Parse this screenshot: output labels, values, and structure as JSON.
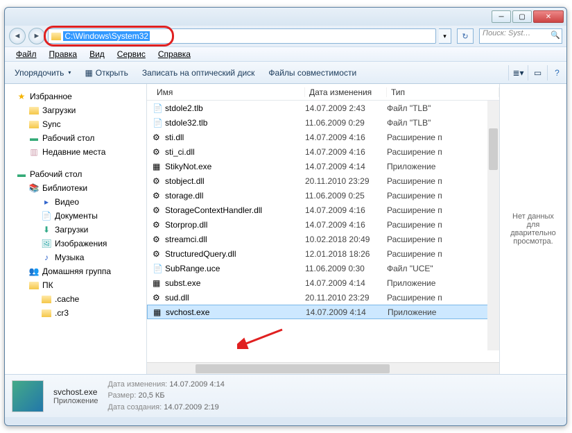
{
  "address_path": "C:\\Windows\\System32",
  "search_placeholder": "Поиск: Syst…",
  "menubar": [
    "Файл",
    "Правка",
    "Вид",
    "Сервис",
    "Справка"
  ],
  "toolbar": {
    "organize": "Упорядочить",
    "open": "Открыть",
    "burn": "Записать на оптический диск",
    "compat": "Файлы совместимости"
  },
  "columns": {
    "name": "Имя",
    "date": "Дата изменения",
    "type": "Тип"
  },
  "tree": {
    "favorites": "Избранное",
    "downloads": "Загрузки",
    "sync": "Sync",
    "desktop_fav": "Рабочий стол",
    "recent": "Недавние места",
    "desktop": "Рабочий стол",
    "libraries": "Библиотеки",
    "video": "Видео",
    "documents": "Документы",
    "downloads2": "Загрузки",
    "pictures": "Изображения",
    "music": "Музыка",
    "homegroup": "Домашняя группа",
    "pc": "ПК",
    "cache": ".cache",
    "cr3": ".cr3"
  },
  "files": [
    {
      "icon": "📄",
      "name": "stdole2.tlb",
      "date": "14.07.2009 2:43",
      "type": "Файл \"TLB\""
    },
    {
      "icon": "📄",
      "name": "stdole32.tlb",
      "date": "11.06.2009 0:29",
      "type": "Файл \"TLB\""
    },
    {
      "icon": "⚙",
      "name": "sti.dll",
      "date": "14.07.2009 4:16",
      "type": "Расширение п"
    },
    {
      "icon": "⚙",
      "name": "sti_ci.dll",
      "date": "14.07.2009 4:16",
      "type": "Расширение п"
    },
    {
      "icon": "▦",
      "name": "StikyNot.exe",
      "date": "14.07.2009 4:14",
      "type": "Приложение"
    },
    {
      "icon": "⚙",
      "name": "stobject.dll",
      "date": "20.11.2010 23:29",
      "type": "Расширение п"
    },
    {
      "icon": "⚙",
      "name": "storage.dll",
      "date": "11.06.2009 0:25",
      "type": "Расширение п"
    },
    {
      "icon": "⚙",
      "name": "StorageContextHandler.dll",
      "date": "14.07.2009 4:16",
      "type": "Расширение п"
    },
    {
      "icon": "⚙",
      "name": "Storprop.dll",
      "date": "14.07.2009 4:16",
      "type": "Расширение п"
    },
    {
      "icon": "⚙",
      "name": "streamci.dll",
      "date": "10.02.2018 20:49",
      "type": "Расширение п"
    },
    {
      "icon": "⚙",
      "name": "StructuredQuery.dll",
      "date": "12.01.2018 18:26",
      "type": "Расширение п"
    },
    {
      "icon": "📄",
      "name": "SubRange.uce",
      "date": "11.06.2009 0:30",
      "type": "Файл \"UCE\""
    },
    {
      "icon": "▦",
      "name": "subst.exe",
      "date": "14.07.2009 4:14",
      "type": "Приложение"
    },
    {
      "icon": "⚙",
      "name": "sud.dll",
      "date": "20.11.2010 23:29",
      "type": "Расширение п"
    },
    {
      "icon": "▦",
      "name": "svchost.exe",
      "date": "14.07.2009 4:14",
      "type": "Приложение",
      "selected": true
    }
  ],
  "preview_text": "Нет данных для дварительно просмотра.",
  "details": {
    "filename": "svchost.exe",
    "filetype": "Приложение",
    "modified_label": "Дата изменения:",
    "modified": "14.07.2009 4:14",
    "size_label": "Размер:",
    "size": "20,5 КБ",
    "created_label": "Дата создания:",
    "created": "14.07.2009 2:19"
  }
}
